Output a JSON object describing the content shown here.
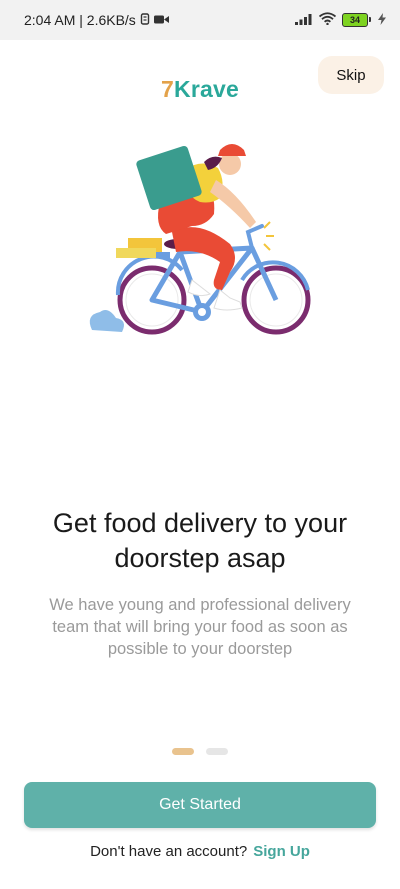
{
  "status_bar": {
    "time_and_speed": "2:04 AM | 2.6KB/s",
    "battery_level": "34",
    "icons": [
      "sim-icon",
      "video-icon",
      "signal-icon",
      "wifi-icon",
      "battery-icon",
      "charging-icon"
    ]
  },
  "header": {
    "logo_number": "7",
    "logo_text": "Krave",
    "skip_label": "Skip"
  },
  "illustration": {
    "icon": "delivery-bike-illustration-icon"
  },
  "onboarding": {
    "title": "Get food delivery to your doorstep asap",
    "description": "We have young and professional delivery team that will bring your food as soon as possible to your doorstep",
    "current_page": 1,
    "total_pages": 2
  },
  "actions": {
    "get_started_label": "Get Started",
    "account_prompt": "Don't have an account?",
    "sign_up_label": "Sign Up"
  },
  "colors": {
    "brand_teal": "#5fb1a9",
    "logo_teal": "#2aa89a",
    "accent_gold": "#e3a24a",
    "skip_bg": "#fbf1e6"
  }
}
